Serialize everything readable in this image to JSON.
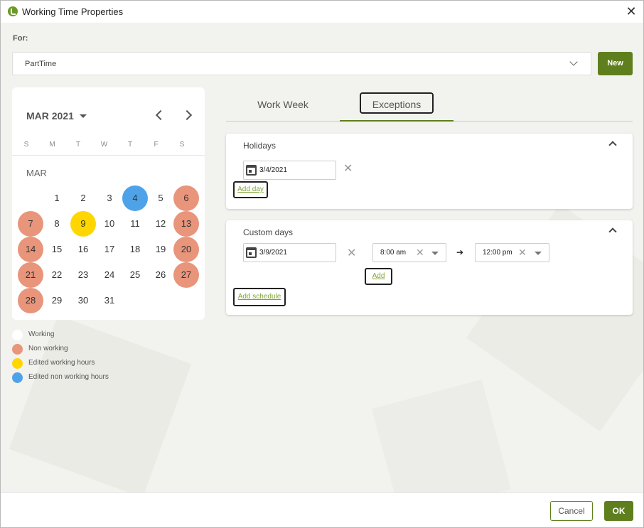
{
  "window": {
    "title": "Working Time Properties"
  },
  "for_section": {
    "label": "For:",
    "selected": "PartTime",
    "new_label": "New"
  },
  "calendar": {
    "month_year": "MAR 2021",
    "month_label": "MAR",
    "weekdays": [
      "S",
      "M",
      "T",
      "W",
      "T",
      "F",
      "S"
    ],
    "days": [
      {
        "d": "1",
        "s": "working"
      },
      {
        "d": "2",
        "s": "working"
      },
      {
        "d": "3",
        "s": "working"
      },
      {
        "d": "4",
        "s": "edited-non"
      },
      {
        "d": "5",
        "s": "working"
      },
      {
        "d": "6",
        "s": "nonwork"
      },
      {
        "d": "7",
        "s": "nonwork"
      },
      {
        "d": "8",
        "s": "working"
      },
      {
        "d": "9",
        "s": "edited-work"
      },
      {
        "d": "10",
        "s": "working"
      },
      {
        "d": "11",
        "s": "working"
      },
      {
        "d": "12",
        "s": "working"
      },
      {
        "d": "13",
        "s": "nonwork"
      },
      {
        "d": "14",
        "s": "nonwork"
      },
      {
        "d": "15",
        "s": "working"
      },
      {
        "d": "16",
        "s": "working"
      },
      {
        "d": "17",
        "s": "working"
      },
      {
        "d": "18",
        "s": "working"
      },
      {
        "d": "19",
        "s": "working"
      },
      {
        "d": "20",
        "s": "nonwork"
      },
      {
        "d": "21",
        "s": "nonwork"
      },
      {
        "d": "22",
        "s": "working"
      },
      {
        "d": "23",
        "s": "working"
      },
      {
        "d": "24",
        "s": "working"
      },
      {
        "d": "25",
        "s": "working"
      },
      {
        "d": "26",
        "s": "working"
      },
      {
        "d": "27",
        "s": "nonwork"
      },
      {
        "d": "28",
        "s": "nonwork"
      },
      {
        "d": "29",
        "s": "working"
      },
      {
        "d": "30",
        "s": "working"
      },
      {
        "d": "31",
        "s": "working"
      }
    ],
    "first_weekday": 1
  },
  "legend": [
    {
      "label": "Working",
      "color": "#ffffff"
    },
    {
      "label": "Non working",
      "color": "#e8957b"
    },
    {
      "label": "Edited working hours",
      "color": "#ffd600"
    },
    {
      "label": "Edited non working hours",
      "color": "#4ea3e8"
    }
  ],
  "tabs": {
    "work_week": "Work Week",
    "exceptions": "Exceptions"
  },
  "holidays": {
    "title": "Holidays",
    "date": "3/4/2021",
    "add_label": "Add day"
  },
  "custom_days": {
    "title": "Custom days",
    "date": "3/9/2021",
    "start_time": "8:00 am",
    "end_time": "12:00 pm",
    "add_label": "Add",
    "add_schedule_label": "Add schedule"
  },
  "footer": {
    "cancel_label": "Cancel",
    "ok_label": "OK"
  },
  "colors": {
    "accent": "#5f7f1f",
    "link": "#7fa630"
  }
}
